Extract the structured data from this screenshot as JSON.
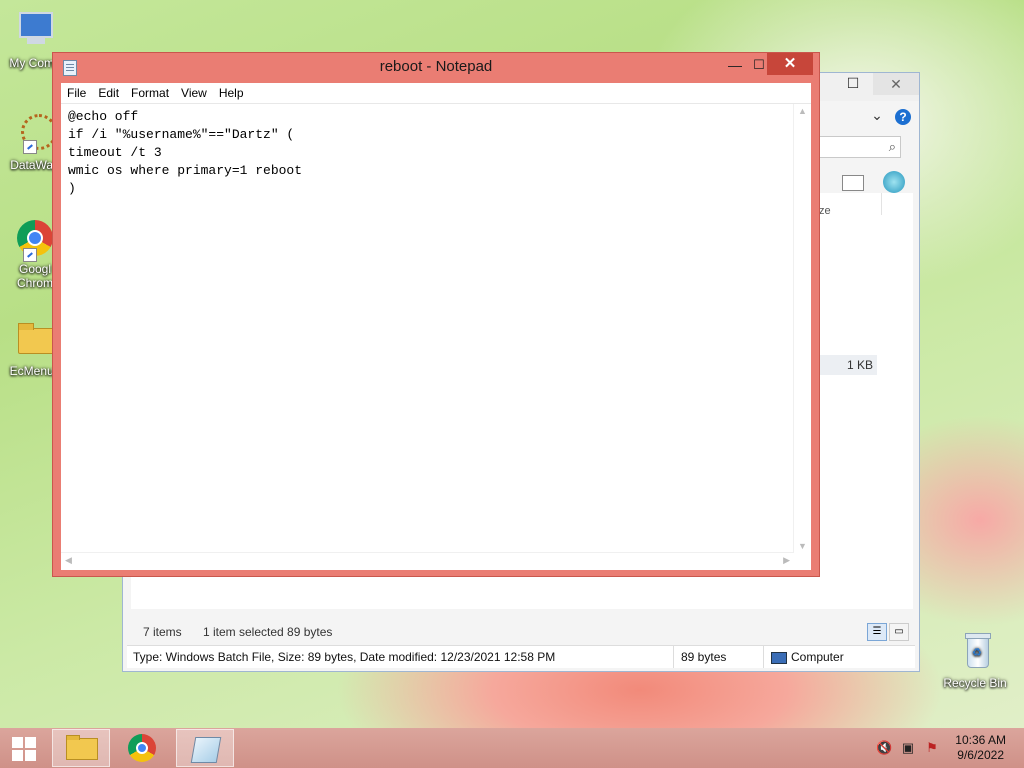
{
  "desktop": {
    "icons": [
      {
        "label": "My Comp"
      },
      {
        "label": "DataWag"
      },
      {
        "label": "Googl\nChrom"
      },
      {
        "label": "EcMenu_"
      },
      {
        "label": "Recycle Bin"
      }
    ]
  },
  "explorer": {
    "size_cell": "1 KB",
    "column_fragment": "ze",
    "status_items": "7 items",
    "status_selected": "1 item selected  89 bytes",
    "details": "Type: Windows Batch File, Size: 89 bytes, Date modified: 12/23/2021 12:58 PM",
    "details_size": "89 bytes",
    "details_location": "Computer"
  },
  "notepad": {
    "title": "reboot - Notepad",
    "menu": [
      "File",
      "Edit",
      "Format",
      "View",
      "Help"
    ],
    "content": "@echo off\nif /i \"%username%\"==\"Dartz\" (\ntimeout /t 3\nwmic os where primary=1 reboot\n)"
  },
  "taskbar": {
    "time": "10:36 AM",
    "date": "9/6/2022"
  },
  "colors": {
    "notepad_frame": "#ea7d73",
    "close_button": "#c7463a",
    "taskbar": "#d49a91"
  },
  "icons": [
    "computer-icon",
    "datawag-icon",
    "chrome-icon",
    "folder-icon",
    "recycle-bin-icon",
    "start-icon",
    "file-explorer-icon",
    "notepad-icon",
    "speaker-muted-icon",
    "network-icon",
    "action-center-icon"
  ]
}
